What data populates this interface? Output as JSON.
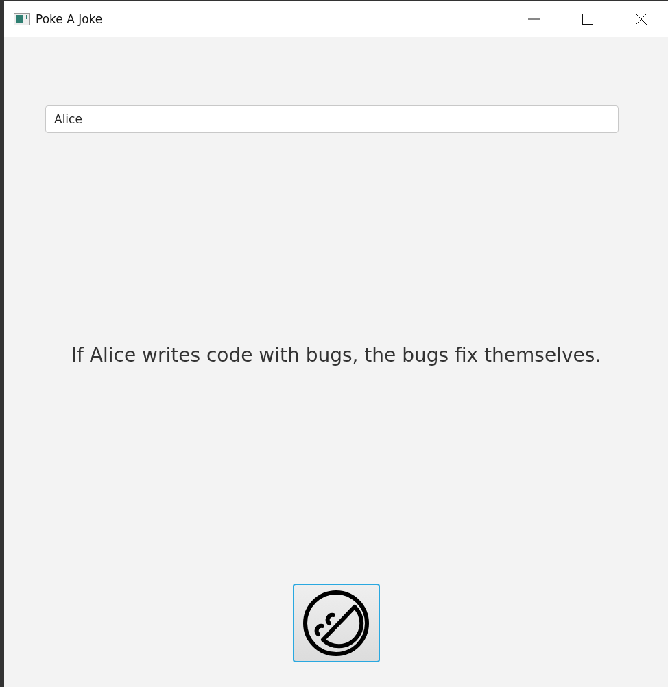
{
  "window": {
    "title": "Poke A Joke"
  },
  "name_field": {
    "value": "Alice"
  },
  "joke": "If Alice writes code with bugs, the bugs fix themselves.",
  "joke_button": {
    "focused": true
  }
}
